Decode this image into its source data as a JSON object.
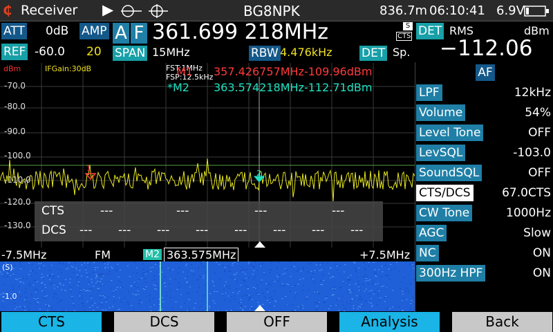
{
  "topbar": {
    "app_icon": "signal-logo-icon",
    "app_icon_glyph": "₵",
    "app_title": "Receiver",
    "play_glyph": "▶",
    "callsign": "BG8NPK",
    "altitude": "836.7m",
    "time": "06:10:41",
    "battery": "6.9V"
  },
  "header": {
    "att_label": "ATT",
    "att_value": "0dB",
    "amp_label": "AMP",
    "amp_value": "20",
    "ref_label": "REF",
    "ref_value": "-60.0",
    "mode_a": "A",
    "mode_f": "F",
    "frequency": "361.699 218MHz",
    "s_badge": "S",
    "cts_badge": "CTS",
    "span_label": "SPAN",
    "span_value": "15MHz",
    "rbw_label": "RBW",
    "rbw_value": "4.476kHz",
    "det_label": "DET",
    "det_value": "Sp.",
    "det2_label": "DET",
    "det2_mode": "RMS",
    "level_unit": "dBm",
    "level_value": "−112.06"
  },
  "spectrum": {
    "unit": "dBm",
    "if_gain": "IFGain:30dB",
    "fst": "FST:1MHz",
    "fsp": "FSP:12.5kHz",
    "m1_label": "M1",
    "m1_value": "357.426757MHz-109.96dBm",
    "m2_label": "*M2",
    "m2_value": "363.574218MHz-112.71dBm",
    "y_ticks": [
      "-70.0",
      "-80.0",
      "-90.0",
      "-100.0",
      "-110.0",
      "-120.0",
      "-130.0"
    ],
    "marker1_tag": "1",
    "marker2_tag": "2",
    "cts_row_label": "CTS",
    "dcs_row_label": "DCS",
    "placeholder_dash": "---"
  },
  "freq_axis": {
    "left": "-7.5MHz",
    "mode": "FM",
    "marker_tag": "M2",
    "marker_freq": "363.575MHz",
    "right": "+7.5MHz"
  },
  "waterfall": {
    "unit": "(S)",
    "tick": "-1.0"
  },
  "af_panel": {
    "title": "AF",
    "rows": [
      {
        "label": "LPF",
        "value": "12kHz"
      },
      {
        "label": "Volume",
        "value": "54%"
      },
      {
        "label": "Level Tone",
        "value": "OFF"
      },
      {
        "label": "LevSQL",
        "value": "-103.0"
      },
      {
        "label": "SoundSQL",
        "value": "OFF"
      },
      {
        "label": "CTS/DCS",
        "value": "67.0CTS"
      },
      {
        "label": "CW Tone",
        "value": "1000Hz"
      },
      {
        "label": "AGC",
        "value": "Slow"
      },
      {
        "label": "NC",
        "value": "ON"
      },
      {
        "label": "300Hz HPF",
        "value": "ON"
      }
    ]
  },
  "softkeys": [
    {
      "label": "CTS",
      "color": "#1ab4e6"
    },
    {
      "label": "DCS",
      "color": "#c8c8c8"
    },
    {
      "label": "OFF",
      "color": "#c8c8c8"
    },
    {
      "label": "Analysis",
      "color": "#1ab4e6"
    },
    {
      "label": "Back",
      "color": "#c8c8c8"
    }
  ],
  "colors": {
    "trace": "#e8e820",
    "m1": "#ff3b3b",
    "m2": "#20e0c0",
    "grid": "#3a3a3a",
    "waterfall_bg": "#1f5fd8"
  }
}
